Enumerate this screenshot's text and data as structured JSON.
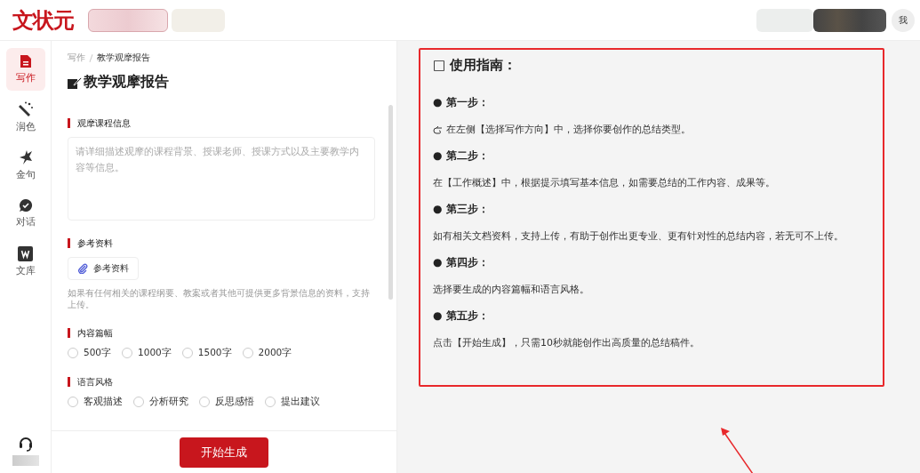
{
  "header": {
    "logo": "文状元",
    "avatar": "我"
  },
  "sidebar": {
    "items": [
      {
        "label": "写作",
        "selected": true
      },
      {
        "label": "润色",
        "selected": false
      },
      {
        "label": "金句",
        "selected": false
      },
      {
        "label": "对话",
        "selected": false
      },
      {
        "label": "文库",
        "selected": false
      }
    ]
  },
  "form": {
    "breadcrumb": [
      "写作",
      "教学观摩报告"
    ],
    "title": "教学观摩报告",
    "sections": [
      {
        "kind": "textarea",
        "label": "观摩课程信息",
        "placeholder": "请详细描述观摩的课程背景、授课老师、授课方式以及主要教学内容等信息。"
      },
      {
        "kind": "upload",
        "label": "参考资料",
        "button": "参考资料",
        "hint": "如果有任何相关的课程纲要、教案或者其他可提供更多背景信息的资料，支持上传。"
      },
      {
        "kind": "radio",
        "label": "内容篇幅",
        "options": [
          {
            "label": "500字",
            "selected": false
          },
          {
            "label": "1000字",
            "selected": false
          },
          {
            "label": "1500字",
            "selected": false
          },
          {
            "label": "2000字",
            "selected": false
          }
        ]
      },
      {
        "kind": "radio",
        "label": "语言风格",
        "options": [
          {
            "label": "客观描述",
            "selected": false
          },
          {
            "label": "分析研究",
            "selected": false
          },
          {
            "label": "反思感悟",
            "selected": false
          },
          {
            "label": "提出建议",
            "selected": false
          }
        ]
      }
    ],
    "submit": "开始生成"
  },
  "guide": {
    "title": "□ 使用指南：",
    "steps": [
      {
        "heading": "● 第一步：",
        "text": "在左侧【选择写作方向】中，选择你要创作的总结类型。",
        "pointer": true
      },
      {
        "heading": "● 第二步：",
        "text": "在【工作概述】中，根据提示填写基本信息，如需要总结的工作内容、成果等。",
        "pointer": false
      },
      {
        "heading": "● 第三步：",
        "text": "如有相关文档资料，支持上传，有助于创作出更专业、更有针对性的总结内容，若无可不上传。",
        "pointer": false
      },
      {
        "heading": "● 第四步：",
        "text": "选择要生成的内容篇幅和语言风格。",
        "pointer": false
      },
      {
        "heading": "● 第五步：",
        "text": "点击【开始生成】，只需10秒就能创作出高质量的总结稿件。",
        "pointer": false
      }
    ]
  }
}
